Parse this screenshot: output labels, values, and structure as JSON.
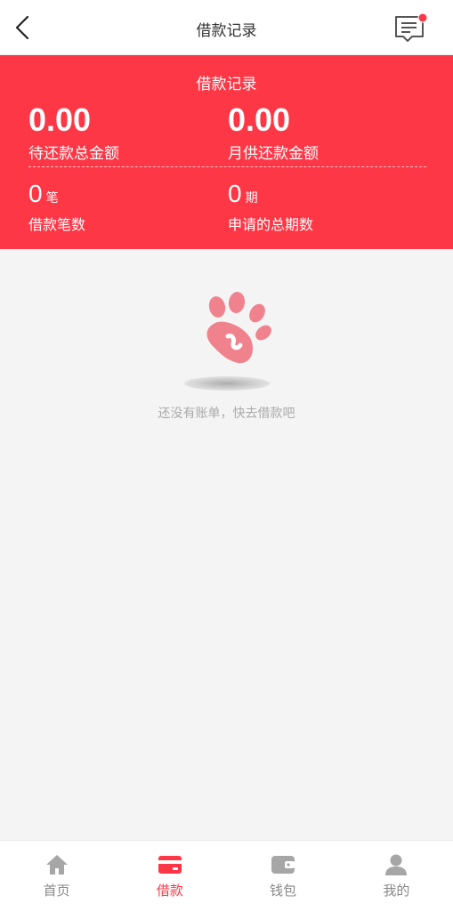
{
  "header": {
    "title": "借款记录",
    "back_icon": "back-chevron-icon",
    "message_icon": "message-notification-icon"
  },
  "summary": {
    "title": "借款记录",
    "pending_total": {
      "value": "0.00",
      "label": "待还款总金额"
    },
    "monthly_payment": {
      "value": "0.00",
      "label": "月供还款金额"
    },
    "loan_count": {
      "value": "0",
      "unit": "笔",
      "label": "借款笔数"
    },
    "total_periods": {
      "value": "0",
      "unit": "期",
      "label": "申请的总期数"
    },
    "background_color": "#fe3746"
  },
  "empty_state": {
    "icon": "paw-icon",
    "text": "还没有账单，快去借款吧"
  },
  "tabbar": {
    "active_color": "#fe3746",
    "items": [
      {
        "label": "首页",
        "icon": "home-icon"
      },
      {
        "label": "借款",
        "icon": "card-icon"
      },
      {
        "label": "钱包",
        "icon": "wallet-icon"
      },
      {
        "label": "我的",
        "icon": "user-icon"
      }
    ]
  }
}
